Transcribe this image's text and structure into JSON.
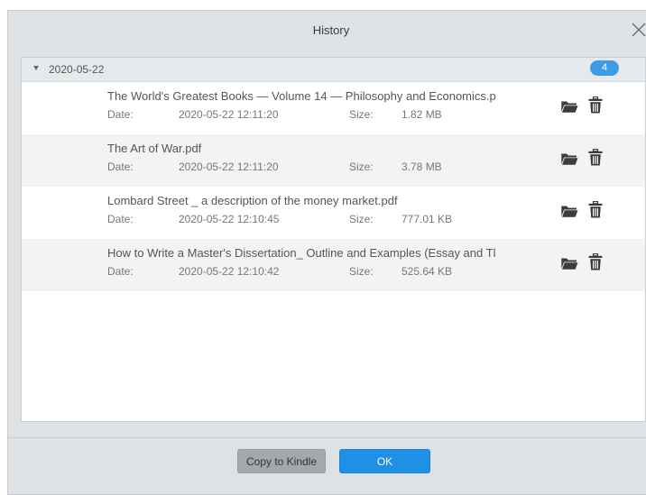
{
  "dialog": {
    "title": "History",
    "close_icon": "close-icon"
  },
  "group": {
    "date": "2020-05-22",
    "count": "4",
    "expanded": true
  },
  "labels": {
    "date": "Date:",
    "size": "Size:"
  },
  "files": [
    {
      "name": "The World's Greatest Books — Volume 14 — Philosophy and Economics.p",
      "date": "2020-05-22 12:11:20",
      "size": "1.82 MB"
    },
    {
      "name": "The Art of War.pdf",
      "date": "2020-05-22 12:11:20",
      "size": "3.78 MB"
    },
    {
      "name": "Lombard Street _ a description of the money market.pdf",
      "date": "2020-05-22 12:10:45",
      "size": "777.01 KB"
    },
    {
      "name": "How to Write a Master's Dissertation_ Outline and Examples (Essay and Tl",
      "date": "2020-05-22 12:10:42",
      "size": "525.64 KB"
    }
  ],
  "row_icons": [
    "folder-icon",
    "trash-icon"
  ],
  "buttons": {
    "copy_to_kindle": "Copy to Kindle",
    "ok": "OK"
  },
  "colors": {
    "accent": "#1e90e6",
    "badge": "#3d9ce6",
    "secondary_button": "#a5a8aa",
    "dialog_background": "#dfe2e5"
  }
}
